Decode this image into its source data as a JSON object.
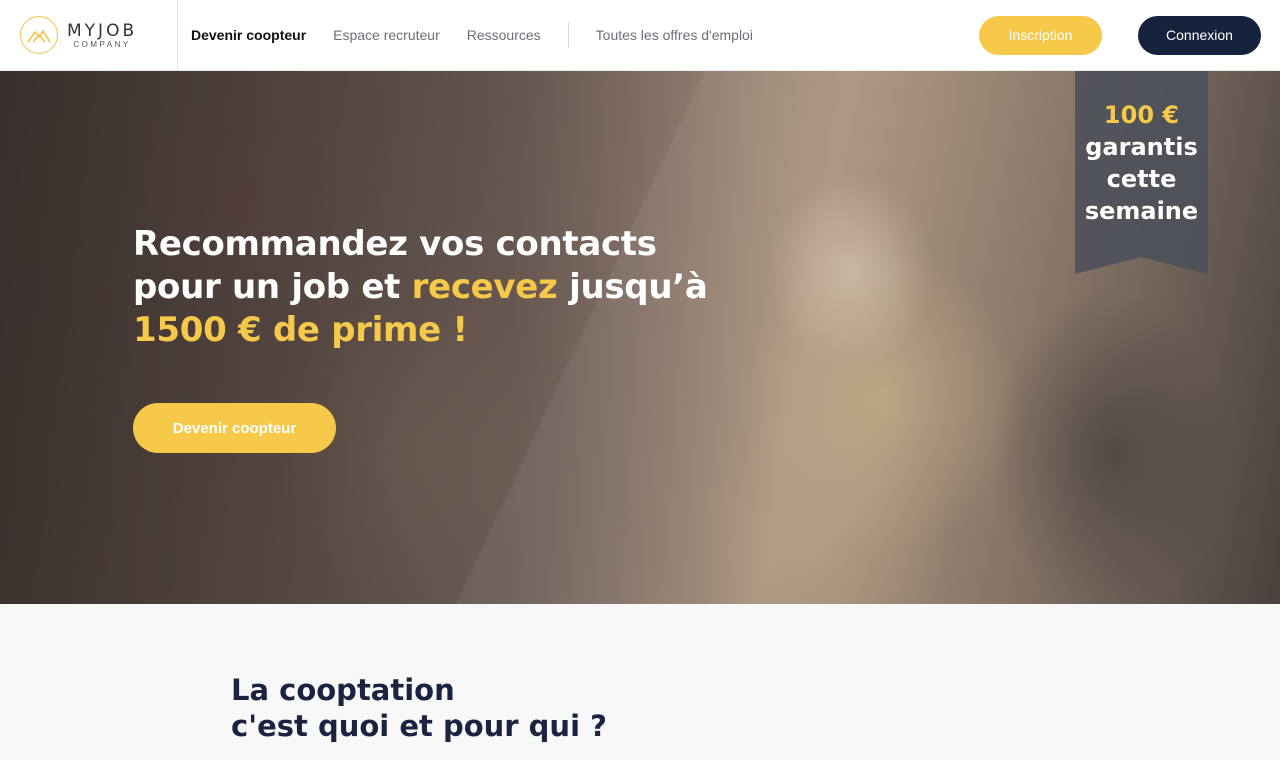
{
  "brand": {
    "name": "MYJOB",
    "sub": "COMPANY",
    "accent": "#f6c94b",
    "navy": "#15233d"
  },
  "nav": {
    "items": [
      {
        "label": "Devenir coopteur",
        "active": true
      },
      {
        "label": "Espace recruteur",
        "active": false
      },
      {
        "label": "Ressources",
        "active": false
      }
    ],
    "all_offers": "Toutes les offres d'emploi",
    "signup": "Inscription",
    "login": "Connexion"
  },
  "hero": {
    "title_1": "Recommandez vos contacts",
    "title_2a": "pour un job et ",
    "title_2b": "recevez",
    "title_2c": " jusqu’à",
    "title_3": "1500 € de prime !",
    "cta": "Devenir coopteur",
    "badge": {
      "amount": "100 €",
      "line1": "garantis",
      "line2": "cette",
      "line3": "semaine"
    }
  },
  "section": {
    "title_1": "La cooptation",
    "title_2": "c'est quoi et pour qui ?"
  }
}
